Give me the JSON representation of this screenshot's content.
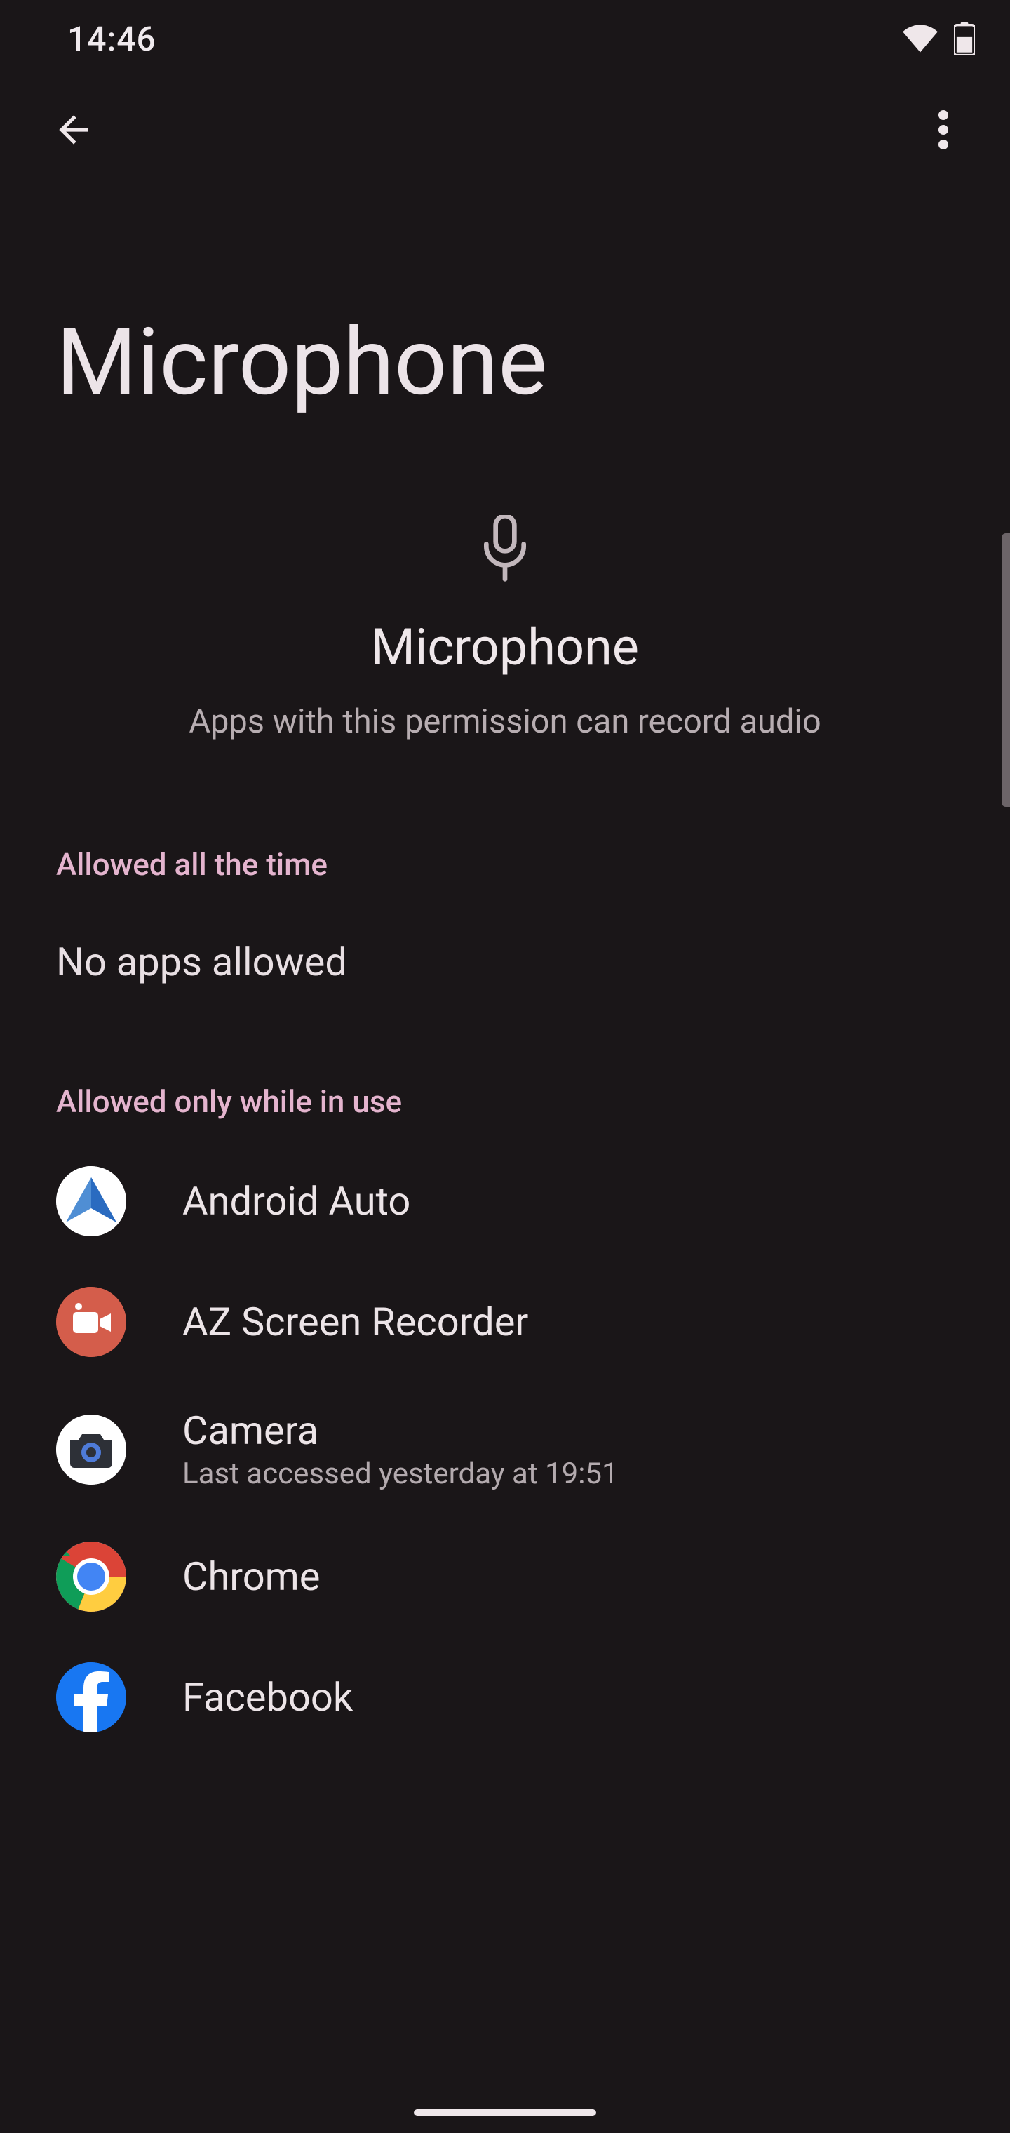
{
  "status": {
    "time": "14:46"
  },
  "page": {
    "title": "Microphone"
  },
  "permission": {
    "name": "Microphone",
    "description": "Apps with this permission can record audio"
  },
  "sections": {
    "all_time": {
      "header": "Allowed all the time",
      "empty_label": "No apps allowed"
    },
    "while_in_use": {
      "header": "Allowed only while in use",
      "apps": [
        {
          "name": "Android Auto",
          "sub": ""
        },
        {
          "name": "AZ Screen Recorder",
          "sub": ""
        },
        {
          "name": "Camera",
          "sub": "Last accessed yesterday at 19:51"
        },
        {
          "name": "Chrome",
          "sub": ""
        },
        {
          "name": "Facebook",
          "sub": ""
        }
      ]
    }
  }
}
